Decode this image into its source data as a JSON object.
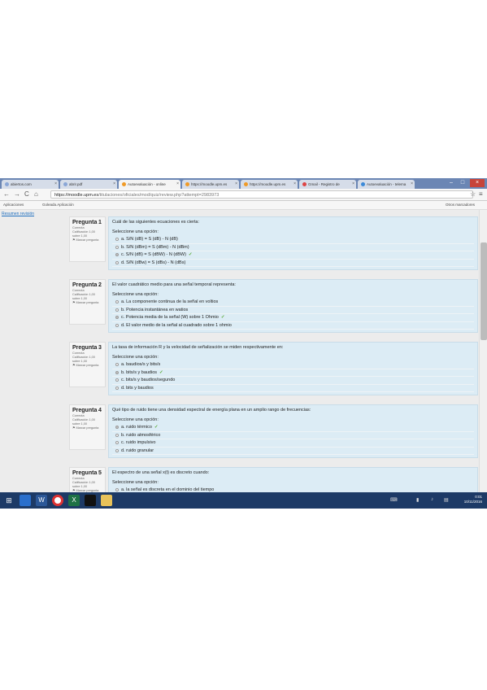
{
  "browser": {
    "tabs": [
      {
        "label": "abiertos.com",
        "color": "#8aa6d6"
      },
      {
        "label": "abrir.pdf",
        "color": "#8aa6d6"
      },
      {
        "label": "Autoevaluación - online",
        "color": "#f09a26"
      },
      {
        "label": "https://moodle.upm.es",
        "color": "#f09a26"
      },
      {
        "label": "https://moodle.upm.es",
        "color": "#f09a26"
      },
      {
        "label": "Gmail - Registro de",
        "color": "#d44"
      },
      {
        "label": "Autoevaluación - telema",
        "color": "#3c8ad8"
      }
    ],
    "nav": {
      "back": "←",
      "forward": "→",
      "reload": "C",
      "home": "⌂"
    },
    "url_host": "https://moodle.upm.es",
    "url_path": "/titulaciones/oficiales/mod/quiz/review.php?attempt=2983973",
    "star": "☆",
    "menu": "≡",
    "bookmarks": {
      "apps": "Aplicaciones",
      "item1": "Goleada.Aplicación",
      "other": "Otros marcadores"
    }
  },
  "left_nav": {
    "link": "Resumen revisión"
  },
  "questions": [
    {
      "number_label": "Pregunta",
      "number": "1",
      "status": "Correcta",
      "grade": "Calificación 1,00 sobre 1,00",
      "flag": "Marcar pregunta",
      "text": "Cuál de las siguientes ecuaciones es cierta:",
      "prompt": "Seleccione una opción:",
      "options": [
        {
          "label": "a. S/N (dB) = S (dB) - N (dB)",
          "selected": false,
          "correct": false
        },
        {
          "label": "b. S/N (dBm) = S (dBm) - N (dBm)",
          "selected": false,
          "correct": false
        },
        {
          "label": "c. S/N (dB) = S (dBW) - N (dBW)",
          "selected": true,
          "correct": true
        },
        {
          "label": "d. S/N (dBw) = S (dBs) - N (dBs)",
          "selected": false,
          "correct": false
        }
      ]
    },
    {
      "number_label": "Pregunta",
      "number": "2",
      "status": "Correcta",
      "grade": "Calificación 1,00 sobre 1,00",
      "flag": "Marcar pregunta",
      "text": "El valor cuadrático medio para una señal temporal representa:",
      "prompt": "Seleccione una opción:",
      "options": [
        {
          "label": "a. La componente continua de la señal en voltios",
          "selected": false,
          "correct": false
        },
        {
          "label": "b. Potencia instantánea en watios",
          "selected": false,
          "correct": false
        },
        {
          "label": "c. Potencia media de la señal (W) sobre 1 Ohmio",
          "selected": true,
          "correct": true
        },
        {
          "label": "d. El valor medio de la señal al cuadrado sobre 1 ohmio",
          "selected": false,
          "correct": false
        }
      ]
    },
    {
      "number_label": "Pregunta",
      "number": "3",
      "status": "Correcta",
      "grade": "Calificación 1,00 sobre 1,00",
      "flag": "Marcar pregunta",
      "text": "La tasa de información R y la velocidad de señalización se miden respectivamente en:",
      "prompt": "Seleccione una opción:",
      "options": [
        {
          "label": "a. baudios/s y bits/s",
          "selected": false,
          "correct": false
        },
        {
          "label": "b. bits/s y baudios",
          "selected": true,
          "correct": true
        },
        {
          "label": "c. bits/s y baudios/segundo",
          "selected": false,
          "correct": false
        },
        {
          "label": "d. bits y baudios",
          "selected": false,
          "correct": false
        }
      ]
    },
    {
      "number_label": "Pregunta",
      "number": "4",
      "status": "Correcta",
      "grade": "Calificación 1,00 sobre 1,00",
      "flag": "Marcar pregunta",
      "text": "Qué tipo de ruido tiene una densidad espectral de energía plana en un amplio rango de frecuencias:",
      "prompt": "Seleccione una opción:",
      "options": [
        {
          "label": "a. ruido térmico",
          "selected": true,
          "correct": true
        },
        {
          "label": "b. ruido atmosférico",
          "selected": false,
          "correct": false
        },
        {
          "label": "c. ruido impulsivo",
          "selected": false,
          "correct": false
        },
        {
          "label": "d. ruido granular",
          "selected": false,
          "correct": false
        }
      ]
    },
    {
      "number_label": "Pregunta",
      "number": "5",
      "status": "Correcta",
      "grade": "Calificación 1,00 sobre 1,00",
      "flag": "Marcar pregunta",
      "text": "El espectro de una señal x(t) es discreto cuando:",
      "prompt": "Seleccione una opción:",
      "options": [
        {
          "label": "a. la señal es discreta en el dominio del tiempo",
          "selected": false,
          "correct": false
        }
      ]
    }
  ],
  "taskbar": {
    "time": "0:01",
    "date": "10/11/2016"
  }
}
